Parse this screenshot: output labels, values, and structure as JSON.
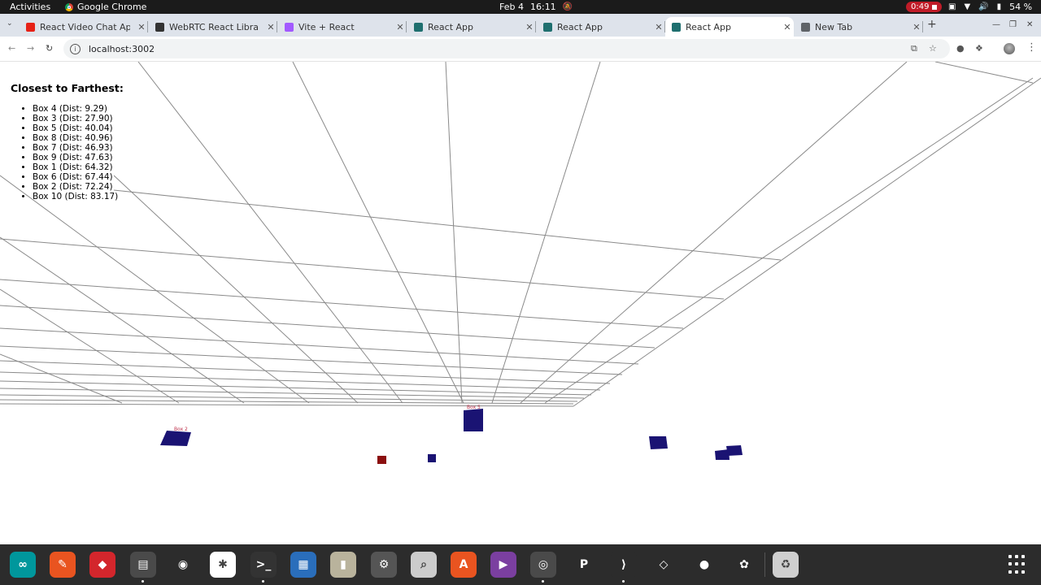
{
  "system_bar": {
    "activities": "Activities",
    "app_name": "Google Chrome",
    "date": "Feb 4",
    "time": "16:11",
    "recording": "0:49",
    "battery": "54 %"
  },
  "tabs": [
    {
      "title": "React Video Chat App | V",
      "favicon_color": "#e62117",
      "active": false
    },
    {
      "title": "WebRTC React Libraries",
      "favicon_color": "#333333",
      "active": false
    },
    {
      "title": "Vite + React",
      "favicon_color": "#a259ff",
      "active": false
    },
    {
      "title": "React App",
      "favicon_color": "#1f6f6f",
      "active": false
    },
    {
      "title": "React App",
      "favicon_color": "#1f6f6f",
      "active": false
    },
    {
      "title": "React App",
      "favicon_color": "#1f6f6f",
      "active": true
    },
    {
      "title": "New Tab",
      "favicon_color": "#5f6368",
      "active": false
    }
  ],
  "address_bar": {
    "url": "localhost:3002"
  },
  "overlay": {
    "heading": "Closest to Farthest:",
    "items": [
      "Box 4 (Dist: 9.29)",
      "Box 3 (Dist: 27.90)",
      "Box 5 (Dist: 40.04)",
      "Box 8 (Dist: 40.96)",
      "Box 7 (Dist: 46.93)",
      "Box 9 (Dist: 47.63)",
      "Box 1 (Dist: 64.32)",
      "Box 6 (Dist: 67.44)",
      "Box 2 (Dist: 72.24)",
      "Box 10 (Dist: 83.17)"
    ]
  },
  "scene": {
    "box_color": "#1a1373",
    "highlight_box_color": "#8b0f0f",
    "grid_color": "#8a8a8a",
    "box_labels": {
      "box5": "Box 5",
      "box2": "Box 2"
    }
  },
  "dock": {
    "apps": [
      {
        "name": "arduino",
        "color": "#00979c",
        "glyph": "∞"
      },
      {
        "name": "pencil",
        "color": "#e95420",
        "glyph": "✎"
      },
      {
        "name": "git",
        "color": "#d3262c",
        "glyph": "◆"
      },
      {
        "name": "files",
        "color": "#4a4a4a",
        "glyph": "▤"
      },
      {
        "name": "blender",
        "color": "#2c2c2c",
        "glyph": "◉"
      },
      {
        "name": "slack",
        "color": "#ffffff",
        "glyph": "✱"
      },
      {
        "name": "terminal",
        "color": "#333333",
        "glyph": ">_"
      },
      {
        "name": "document",
        "color": "#2a6ebb",
        "glyph": "▦"
      },
      {
        "name": "archive",
        "color": "#b9b39c",
        "glyph": "▮"
      },
      {
        "name": "settings",
        "color": "#555555",
        "glyph": "⚙"
      },
      {
        "name": "search",
        "color": "#cccccc",
        "glyph": "⌕"
      },
      {
        "name": "software",
        "color": "#e95420",
        "glyph": "A"
      },
      {
        "name": "video",
        "color": "#7b3fa0",
        "glyph": "▶"
      },
      {
        "name": "chrome",
        "color": "#4a4a4a",
        "glyph": "◎"
      },
      {
        "name": "p-app",
        "color": "#2c2c2c",
        "glyph": "P"
      },
      {
        "name": "vscode",
        "color": "#2c2c2c",
        "glyph": "⟩"
      },
      {
        "name": "unity",
        "color": "#2c2c2c",
        "glyph": "◇"
      },
      {
        "name": "globe",
        "color": "#2c2c2c",
        "glyph": "●"
      },
      {
        "name": "figma",
        "color": "#2c2c2c",
        "glyph": "✿"
      },
      {
        "name": "trash",
        "color": "#cfcfcf",
        "glyph": "♻"
      }
    ]
  }
}
